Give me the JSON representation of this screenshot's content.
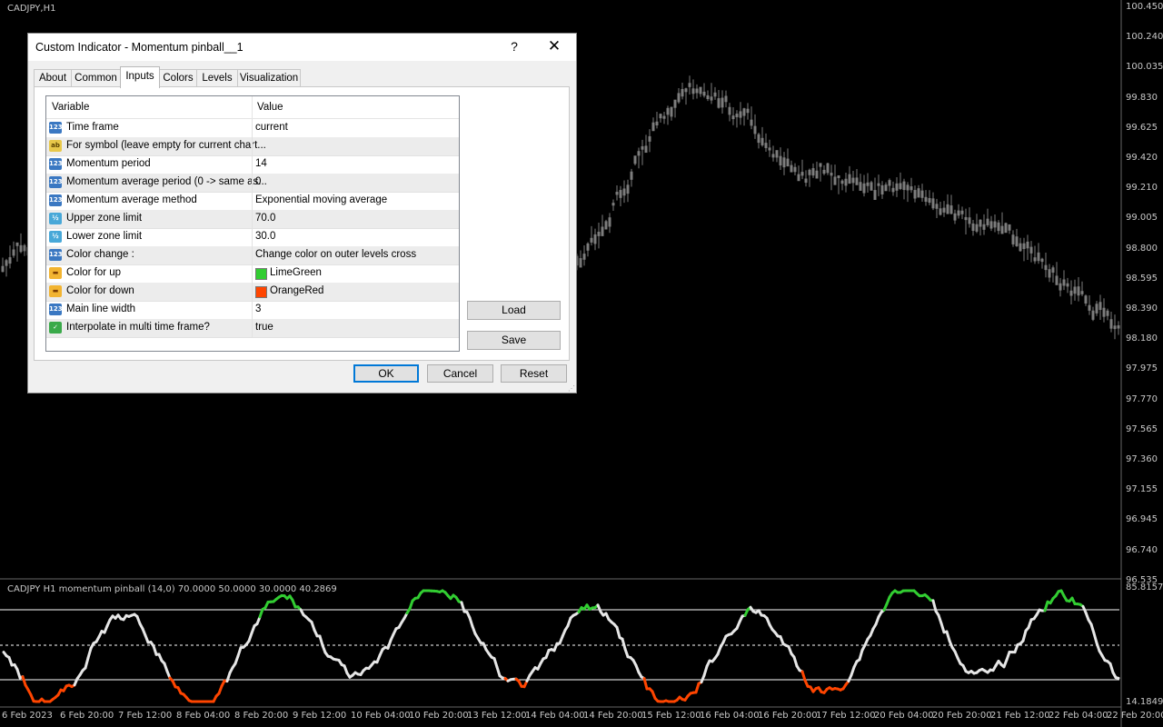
{
  "chart": {
    "symbol_title": "CADJPY,H1",
    "indicator_title": "CADJPY H1 momentum pinball (14,0) 70.0000 50.0000 30.0000 40.2869",
    "price_labels": [
      "100.450",
      "100.240",
      "100.035",
      "99.830",
      "99.625",
      "99.420",
      "99.210",
      "99.005",
      "98.800",
      "98.595",
      "98.390",
      "98.180",
      "97.975",
      "97.770",
      "97.565",
      "97.360",
      "97.155",
      "96.945",
      "96.740",
      "96.535"
    ],
    "indicator_labels": [
      "85.8157",
      "14.1849"
    ],
    "time_labels": [
      "6 Feb 2023",
      "6 Feb 20:00",
      "7 Feb 12:00",
      "8 Feb 04:00",
      "8 Feb 20:00",
      "9 Feb 12:00",
      "10 Feb 04:00",
      "10 Feb 20:00",
      "13 Feb 12:00",
      "14 Feb 04:00",
      "14 Feb 20:00",
      "15 Feb 12:00",
      "16 Feb 04:00",
      "16 Feb 20:00",
      "17 Feb 12:00",
      "20 Feb 04:00",
      "20 Feb 20:00",
      "21 Feb 12:00",
      "22 Feb 04:00",
      "22 Feb 20:00"
    ],
    "colors": {
      "background": "#000000",
      "candle": "#7d7d7d",
      "line": "#e6e6e6",
      "up": "#32cd32",
      "down": "#ff4500",
      "level": "#ffffff"
    }
  },
  "dialog": {
    "title": "Custom Indicator - Momentum pinball__1",
    "help_label": "?",
    "close_label": "✕",
    "tabs": [
      "About",
      "Common",
      "Inputs",
      "Colors",
      "Levels",
      "Visualization"
    ],
    "active_tab": "Inputs",
    "grid_headers": {
      "variable": "Variable",
      "value": "Value"
    },
    "params": [
      {
        "icon": "int-icon",
        "icon_text": "123",
        "variable": "Time frame",
        "value": "current"
      },
      {
        "icon": "string-icon",
        "icon_text": "ab",
        "variable": "For symbol (leave empty for current chart...",
        "value": ""
      },
      {
        "icon": "int-icon",
        "icon_text": "123",
        "variable": "Momentum period",
        "value": "14"
      },
      {
        "icon": "int-icon",
        "icon_text": "123",
        "variable": "Momentum average period (0 -> same as...",
        "value": "0"
      },
      {
        "icon": "enum-icon",
        "icon_text": "123",
        "variable": "Momentum average method",
        "value": "Exponential moving average"
      },
      {
        "icon": "double-icon",
        "icon_text": "½",
        "variable": "Upper zone limit",
        "value": "70.0"
      },
      {
        "icon": "double-icon",
        "icon_text": "½",
        "variable": "Lower zone limit",
        "value": "30.0"
      },
      {
        "icon": "enum-icon",
        "icon_text": "123",
        "variable": "Color change :",
        "value": "Change color on outer levels cross"
      },
      {
        "icon": "color-icon",
        "icon_text": "▬",
        "variable": "Color for up",
        "value": "LimeGreen",
        "swatch": "#32cd32"
      },
      {
        "icon": "color-icon",
        "icon_text": "▬",
        "variable": "Color for down",
        "value": "OrangeRed",
        "swatch": "#ff4500"
      },
      {
        "icon": "int-icon",
        "icon_text": "123",
        "variable": "Main line width",
        "value": "3"
      },
      {
        "icon": "bool-icon",
        "icon_text": "✓",
        "variable": "Interpolate in multi time frame?",
        "value": "true"
      }
    ],
    "buttons": {
      "load": "Load",
      "save": "Save",
      "ok": "OK",
      "cancel": "Cancel",
      "reset": "Reset"
    }
  }
}
